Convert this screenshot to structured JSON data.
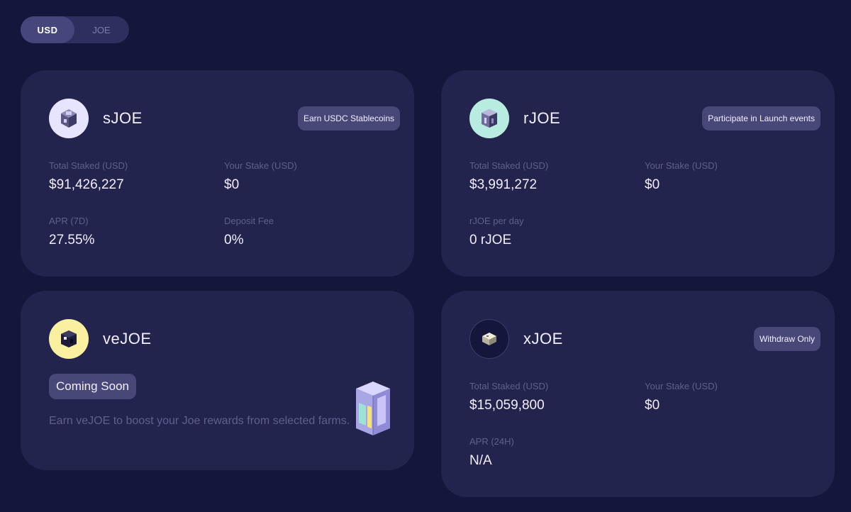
{
  "currency_toggle": {
    "options": [
      "USD",
      "JOE"
    ],
    "selected": "USD"
  },
  "cards": {
    "sjoe": {
      "name": "sJOE",
      "tag": "Earn USDC Stablecoins",
      "logo_icon": "sjoe-token-icon",
      "stats": [
        {
          "label": "Total Staked (USD)",
          "value": "$91,426,227"
        },
        {
          "label": "Your Stake (USD)",
          "value": "$0"
        },
        {
          "label": "APR (7D)",
          "value": "27.55%"
        },
        {
          "label": "Deposit Fee",
          "value": "0%"
        }
      ]
    },
    "rjoe": {
      "name": "rJOE",
      "tag": "Participate in Launch events",
      "logo_icon": "rjoe-token-icon",
      "stats": [
        {
          "label": "Total Staked (USD)",
          "value": "$3,991,272"
        },
        {
          "label": "Your Stake (USD)",
          "value": "$0"
        },
        {
          "label": "rJOE per day",
          "value": "0 rJOE"
        }
      ]
    },
    "vejoe": {
      "name": "veJOE",
      "badge": "Coming Soon",
      "description": "Earn veJOE to boost your Joe rewards from selected farms.",
      "logo_icon": "vejoe-token-icon"
    },
    "xjoe": {
      "name": "xJOE",
      "tag": "Withdraw Only",
      "logo_icon": "xjoe-token-icon",
      "stats": [
        {
          "label": "Total Staked (USD)",
          "value": "$15,059,800"
        },
        {
          "label": "Your Stake (USD)",
          "value": "$0"
        },
        {
          "label": "APR (24H)",
          "value": "N/A"
        }
      ]
    }
  },
  "colors": {
    "background": "#15163b",
    "card": "#23244d",
    "tag": "#474878",
    "muted_label": "#5e5f8f"
  }
}
